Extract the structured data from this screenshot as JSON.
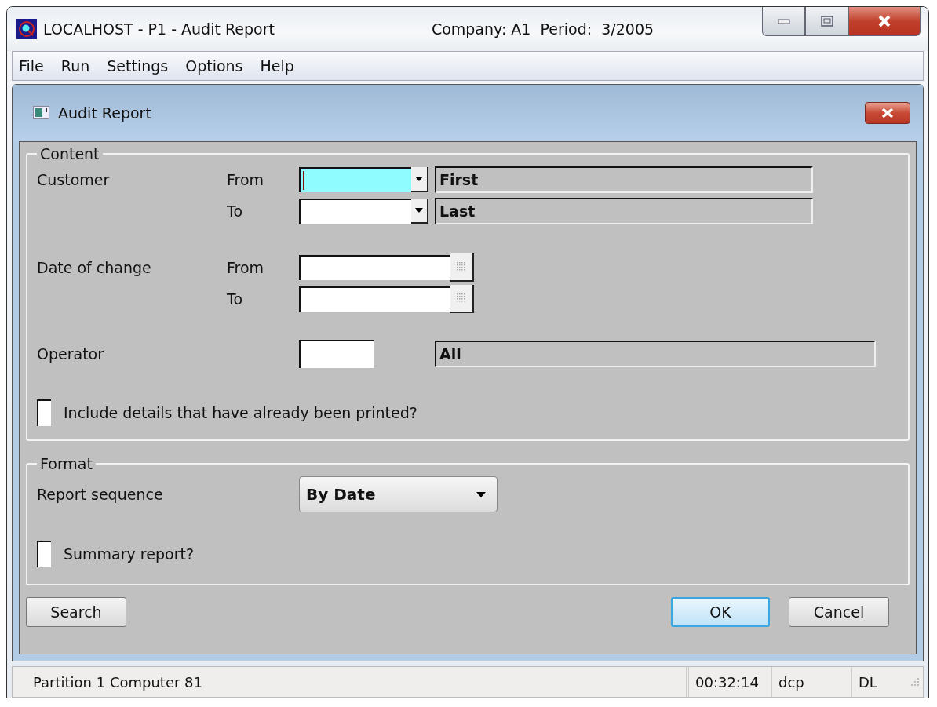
{
  "window": {
    "title": "LOCALHOST - P1 - Audit Report",
    "context": "Company: A1  Period:  3/2005"
  },
  "menu": [
    {
      "label": "File"
    },
    {
      "label": "Run"
    },
    {
      "label": "Settings"
    },
    {
      "label": "Options"
    },
    {
      "label": "Help"
    }
  ],
  "dialog": {
    "title": "Audit Report"
  },
  "groups": [
    {
      "title": "Content",
      "rows": [
        {
          "kind": "lookup",
          "label": "Customer",
          "sublabel": "From",
          "focused": true,
          "description": "First"
        },
        {
          "kind": "lookup",
          "sublabel": "To",
          "focused": false,
          "description": "Last"
        },
        {
          "kind": "date",
          "label": "Date of change",
          "sublabel": "From",
          "focused": false
        },
        {
          "kind": "date",
          "sublabel": "To",
          "focused": false
        },
        {
          "kind": "code",
          "label": "Operator",
          "focused": false,
          "description": "All"
        },
        {
          "kind": "checkbox",
          "label": "Include details that have already been printed?",
          "checked": false
        }
      ]
    },
    {
      "title": "Format",
      "rows": [
        {
          "kind": "select",
          "label": "Report sequence",
          "value": "By Date"
        },
        {
          "kind": "checkbox",
          "label": "Summary report?",
          "checked": false
        }
      ]
    }
  ],
  "buttons": [
    {
      "label": "Search",
      "default": false
    },
    {
      "label": "OK",
      "default": true
    },
    {
      "label": "Cancel",
      "default": false
    }
  ],
  "status_bar": [
    {
      "text": "Partition 1 Computer 81"
    },
    {
      "text": "00:32:14"
    },
    {
      "text": "dcp"
    },
    {
      "text": "DL"
    }
  ]
}
